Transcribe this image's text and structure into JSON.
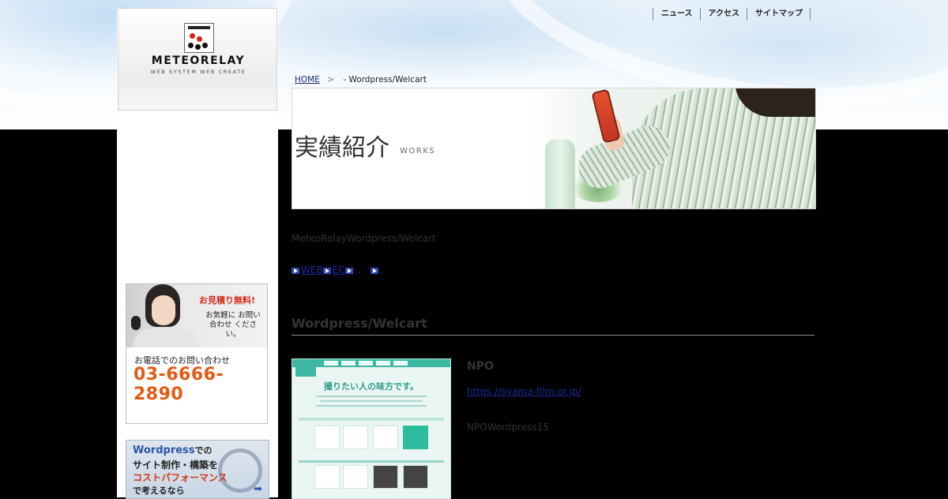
{
  "header": {
    "logo": {
      "name": "METEORELAY",
      "tagline": "WEB SYSTEM WEB CREATE",
      "icon": "meteorelay-logo-mark"
    },
    "nav": [
      {
        "label": "ニュース"
      },
      {
        "label": "アクセス"
      },
      {
        "label": "サイトマップ"
      }
    ]
  },
  "breadcrumb": {
    "home": "HOME",
    "separator": ">",
    "current": "- Wordpress/Welcart"
  },
  "hero": {
    "title": "実績紹介",
    "subtitle": "WORKS"
  },
  "sidebar": {
    "contact_banner": {
      "free_estimate": "お見積り無料!",
      "message": "お気軽に お問い合わせ ください。",
      "tel_label": "お電話でのお問い合わせ",
      "tel": "03-6666-2890"
    },
    "wp_banner": {
      "line1": "Wordpress",
      "line1_suffix": "での",
      "line2": "サイト制作・構築を",
      "line3": "コストパフォーマンス",
      "line4": "で考えるなら",
      "arrow": "➡"
    }
  },
  "main": {
    "intro": "MeteoRelayWordpress/Welcart",
    "tags": [
      {
        "label": "WEB"
      },
      {
        "label": "EC"
      },
      {
        "label": ""
      }
    ],
    "tag_separator": "、",
    "tag_end": ".",
    "section_title": "Wordpress/Welcart",
    "work": {
      "screenshot_headline": "撮りたい人の味方です。",
      "client": "NPO",
      "url": "https://oyama-film.or.jp/",
      "description": "NPOWordpress15"
    }
  },
  "colors": {
    "page_background": "#000000",
    "link": "#1a2a9c",
    "phone_number": "#e45a12",
    "accent_red": "#d42b1a",
    "screenshot_teal": "#3fb8a3"
  }
}
